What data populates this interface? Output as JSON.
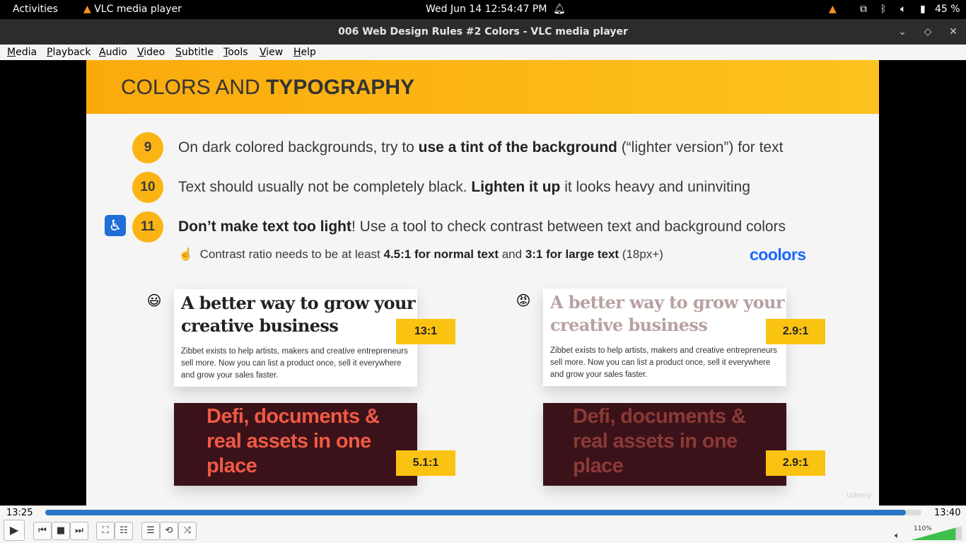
{
  "system_bar": {
    "activities": "Activities",
    "app_name": "VLC media player",
    "clock": "Wed Jun 14  12:54:47 PM",
    "battery": "45 %"
  },
  "window": {
    "title": "006 Web Design Rules #2 Colors - VLC media player"
  },
  "menu": {
    "items": [
      "Media",
      "Playback",
      "Audio",
      "Video",
      "Subtitle",
      "Tools",
      "View",
      "Help"
    ]
  },
  "slide": {
    "title_regular": "COLORS AND ",
    "title_bold": "TYPOGRAPHY",
    "rules": [
      {
        "num": "9",
        "pre": "On dark colored backgrounds, try to ",
        "bold": "use a tint of the background",
        "post": " (“lighter version”) for text"
      },
      {
        "num": "10",
        "pre": "Text should usually not be completely black. ",
        "bold": "Lighten it up",
        "post": " it looks heavy and uninviting"
      },
      {
        "num": "11",
        "pre": "",
        "bold": "Don’t make text too light",
        "post": "! Use a tool to check contrast between text and background colors"
      }
    ],
    "note": {
      "icon": "☝",
      "pre": "Contrast ratio needs to be at least ",
      "bold1": "4.5:1 for normal text",
      "mid": " and ",
      "bold2": "3:1 for large text",
      "post": " (18px+)"
    },
    "coolors_logo": "coolors",
    "good_example": {
      "emoji": "😃",
      "headline_line1": "A better way to grow your",
      "headline_line2": "creative business",
      "body": "Zibbet exists to help artists, makers and creative entrepreneurs sell more. Now you can list a product once, sell it everywhere and grow your sales faster.",
      "ratio_light": "13:1",
      "dark_line1": "Defi, documents &",
      "dark_line2": "real assets in one",
      "dark_line3": "place",
      "ratio_dark": "5.1:1",
      "headline_color": "#222222",
      "dark_text_color": "#ef5a45"
    },
    "bad_example": {
      "emoji": "😡",
      "headline_line1": "A better way to grow your",
      "headline_line2": "creative business",
      "body": "Zibbet exists to help artists, makers and creative entrepreneurs sell more. Now you can list a product once, sell it everywhere and grow your sales faster.",
      "ratio_light": "2.9:1",
      "dark_line1": "Defi, documents &",
      "dark_line2": "real assets in one",
      "dark_line3": "place",
      "ratio_dark": "2.9:1",
      "headline_color": "#b8a1a1",
      "dark_text_color": "#8b3a36"
    },
    "watermark": "Udemy"
  },
  "player": {
    "time_current": "13:25",
    "time_total": "13:40",
    "progress_fraction": 0.982,
    "volume_label": "110%",
    "volume_fraction": 1.1
  },
  "colors": {
    "accent": "#2a76c6",
    "slide_header": "#fbaa0c",
    "ratio_badge": "#fbc311"
  }
}
